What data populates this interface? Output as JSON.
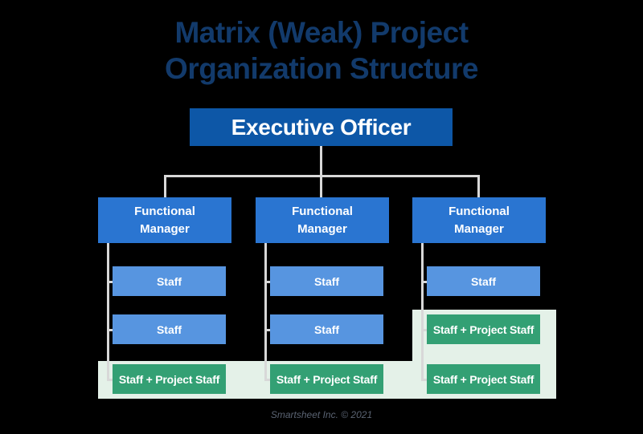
{
  "title": {
    "line1": "Matrix (Weak) Project",
    "line2": "Organization Structure"
  },
  "executive": {
    "label": "Executive Officer"
  },
  "columns": [
    {
      "manager": {
        "line1": "Functional",
        "line2": "Manager"
      },
      "nodes": [
        {
          "label": "Staff",
          "type": "staff"
        },
        {
          "label": "Staff",
          "type": "staff"
        },
        {
          "label": "Staff + Project Staff",
          "type": "green"
        }
      ]
    },
    {
      "manager": {
        "line1": "Functional",
        "line2": "Manager"
      },
      "nodes": [
        {
          "label": "Staff",
          "type": "staff"
        },
        {
          "label": "Staff",
          "type": "staff"
        },
        {
          "label": "Staff + Project Staff",
          "type": "green"
        }
      ]
    },
    {
      "manager": {
        "line1": "Functional",
        "line2": "Manager"
      },
      "nodes": [
        {
          "label": "Staff",
          "type": "staff"
        },
        {
          "label": "Staff + Project Staff",
          "type": "green"
        },
        {
          "label": "Staff + Project Staff",
          "type": "green"
        }
      ]
    }
  ],
  "footer": {
    "text": "Smartsheet Inc. © 2021"
  },
  "colors": {
    "background": "#000000",
    "title": "#123a6b",
    "executive_box": "#0d57a7",
    "manager_box": "#2a75d1",
    "staff_box": "#5795e0",
    "project_box": "#33a074",
    "highlight_band": "#e4f1e8",
    "connector": "#d8d8d8",
    "footer_text": "#5a6372"
  }
}
